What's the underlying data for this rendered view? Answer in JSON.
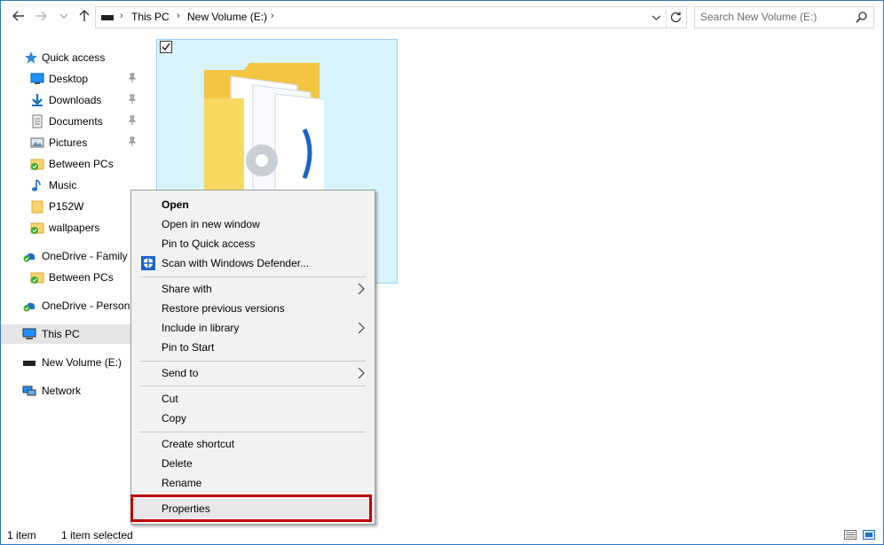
{
  "address_bar": {
    "breadcrumb": [
      "This PC",
      "New Volume (E:)"
    ]
  },
  "search": {
    "placeholder": "Search New Volume (E:)"
  },
  "nav_pane": {
    "quick_access": "Quick access",
    "items": [
      {
        "label": "Desktop",
        "icon": "desktop-icon",
        "pinned": true
      },
      {
        "label": "Downloads",
        "icon": "downloads-icon",
        "pinned": true
      },
      {
        "label": "Documents",
        "icon": "documents-icon",
        "pinned": true
      },
      {
        "label": "Pictures",
        "icon": "pictures-icon",
        "pinned": true
      },
      {
        "label": "Between PCs",
        "icon": "synced-folder-icon",
        "pinned": false
      },
      {
        "label": "Music",
        "icon": "music-icon",
        "pinned": false
      },
      {
        "label": "P152W",
        "icon": "folder-icon",
        "pinned": false
      },
      {
        "label": "wallpapers",
        "icon": "synced-folder-icon",
        "pinned": false
      }
    ],
    "onedrive_family": "OneDrive - Family",
    "onedrive_family_child": "Between PCs",
    "onedrive_personal": "OneDrive - Persona",
    "this_pc": "This PC",
    "new_volume": "New Volume (E:)",
    "network": "Network"
  },
  "context_menu": {
    "items": [
      {
        "label": "Open",
        "bold": true
      },
      {
        "label": "Open in new window"
      },
      {
        "label": "Pin to Quick access"
      },
      {
        "label": "Scan with Windows Defender...",
        "icon": "windows-defender-icon"
      },
      {
        "label": "Share with",
        "submenu": true
      },
      {
        "label": "Restore previous versions"
      },
      {
        "label": "Include in library",
        "submenu": true
      },
      {
        "label": "Pin to Start"
      },
      {
        "label": "Send to",
        "submenu": true
      },
      {
        "label": "Cut"
      },
      {
        "label": "Copy"
      },
      {
        "label": "Create shortcut"
      },
      {
        "label": "Delete"
      },
      {
        "label": "Rename"
      },
      {
        "label": "Properties",
        "highlighted": true
      }
    ]
  },
  "status_bar": {
    "item_count": "1 item",
    "selection": "1 item selected"
  },
  "colors": {
    "window_border": "#2b79c2",
    "selection_fill": "#d9f4fe",
    "highlight_box": "#c00000",
    "menu_background": "#f2f2f2"
  }
}
